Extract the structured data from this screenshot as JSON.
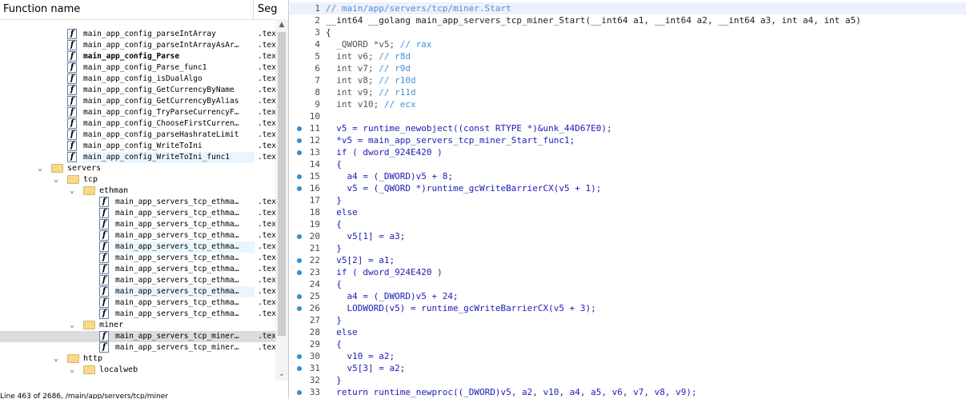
{
  "colors": {
    "comment": "#4a8fd8",
    "code": "#1b1bb8",
    "dot": "#2d8fd5",
    "folder": "#f6d98a",
    "selected_row": "#dcdcdc"
  },
  "func_panel": {
    "col_name": "Function name",
    "col_seg": "Segment",
    "rows": [
      {
        "kind": "fn",
        "indent": 84,
        "name": "main_app_config_parseIntArray",
        "seg": ".text"
      },
      {
        "kind": "fn",
        "indent": 84,
        "name": "main_app_config_parseIntArrayAsAr…",
        "seg": ".text"
      },
      {
        "kind": "fn",
        "indent": 84,
        "name": "main_app_config_Parse",
        "seg": ".text",
        "bold": true
      },
      {
        "kind": "fn",
        "indent": 84,
        "name": "main_app_config_Parse_func1",
        "seg": ".text"
      },
      {
        "kind": "fn",
        "indent": 84,
        "name": "main_app_config_isDualAlgo",
        "seg": ".text"
      },
      {
        "kind": "fn",
        "indent": 84,
        "name": "main_app_config_GetCurrencyByName",
        "seg": ".text"
      },
      {
        "kind": "fn",
        "indent": 84,
        "name": "main_app_config_GetCurrencyByAlias",
        "seg": ".text"
      },
      {
        "kind": "fn",
        "indent": 84,
        "name": "main_app_config_TryParseCurrencyF…",
        "seg": ".text"
      },
      {
        "kind": "fn",
        "indent": 84,
        "name": "main_app_config_ChooseFirstCurren…",
        "seg": ".text"
      },
      {
        "kind": "fn",
        "indent": 84,
        "name": "main_app_config_parseHashrateLimit",
        "seg": ".text"
      },
      {
        "kind": "fn",
        "indent": 84,
        "name": "main_app_config_WriteToIni",
        "seg": ".text"
      },
      {
        "kind": "fn",
        "indent": 84,
        "name": "main_app_config_WriteToIni_func1",
        "seg": ".text",
        "hl": true
      },
      {
        "kind": "folder",
        "indent": 44,
        "name": "servers"
      },
      {
        "kind": "folder",
        "indent": 64,
        "name": "tcp"
      },
      {
        "kind": "folder",
        "indent": 84,
        "name": "ethman"
      },
      {
        "kind": "fn",
        "indent": 124,
        "name": "main_app_servers_tcp_ethma…",
        "seg": ".text"
      },
      {
        "kind": "fn",
        "indent": 124,
        "name": "main_app_servers_tcp_ethma…",
        "seg": ".text"
      },
      {
        "kind": "fn",
        "indent": 124,
        "name": "main_app_servers_tcp_ethma…",
        "seg": ".text"
      },
      {
        "kind": "fn",
        "indent": 124,
        "name": "main_app_servers_tcp_ethma…",
        "seg": ".text"
      },
      {
        "kind": "fn",
        "indent": 124,
        "name": "main_app_servers_tcp_ethma…",
        "seg": ".text",
        "hl": true
      },
      {
        "kind": "fn",
        "indent": 124,
        "name": "main_app_servers_tcp_ethma…",
        "seg": ".text"
      },
      {
        "kind": "fn",
        "indent": 124,
        "name": "main_app_servers_tcp_ethma…",
        "seg": ".text"
      },
      {
        "kind": "fn",
        "indent": 124,
        "name": "main_app_servers_tcp_ethma…",
        "seg": ".text"
      },
      {
        "kind": "fn",
        "indent": 124,
        "name": "main_app_servers_tcp_ethma…",
        "seg": ".text",
        "hl": true
      },
      {
        "kind": "fn",
        "indent": 124,
        "name": "main_app_servers_tcp_ethma…",
        "seg": ".text"
      },
      {
        "kind": "fn",
        "indent": 124,
        "name": "main_app_servers_tcp_ethma…",
        "seg": ".text"
      },
      {
        "kind": "folder",
        "indent": 84,
        "name": "miner"
      },
      {
        "kind": "fn",
        "indent": 124,
        "name": "main_app_servers_tcp_miner…",
        "seg": ".text",
        "selected": true
      },
      {
        "kind": "fn",
        "indent": 124,
        "name": "main_app_servers_tcp_miner…",
        "seg": ".text"
      },
      {
        "kind": "folder",
        "indent": 64,
        "name": "http"
      },
      {
        "kind": "folder",
        "indent": 84,
        "name": "localweb"
      }
    ],
    "status": "Line 463 of 2686, /main/app/servers/tcp/miner"
  },
  "code": {
    "lines": [
      {
        "n": "1",
        "t": "// main/app/servers/tcp/miner.Start",
        "cls": "comment",
        "dot": false,
        "current": true
      },
      {
        "n": "2",
        "t": "__int64 __golang main_app_servers_tcp_miner_Start(__int64 a1, __int64 a2, __int64 a3, int a4, int a5)",
        "cls": "plain",
        "dot": false
      },
      {
        "n": "3",
        "t": "{",
        "cls": "plain",
        "dot": false
      },
      {
        "n": "4",
        "t": "  _QWORD *v5; // rax",
        "cls": "mixed",
        "dot": false
      },
      {
        "n": "5",
        "t": "  int v6; // r8d",
        "cls": "mixed",
        "dot": false
      },
      {
        "n": "6",
        "t": "  int v7; // r9d",
        "cls": "mixed",
        "dot": false
      },
      {
        "n": "7",
        "t": "  int v8; // r10d",
        "cls": "mixed",
        "dot": false
      },
      {
        "n": "8",
        "t": "  int v9; // r11d",
        "cls": "mixed",
        "dot": false
      },
      {
        "n": "9",
        "t": "  int v10; // ecx",
        "cls": "mixed",
        "dot": false
      },
      {
        "n": "10",
        "t": "",
        "cls": "plain",
        "dot": false
      },
      {
        "n": "11",
        "t": "  v5 = runtime_newobject((const RTYPE *)&unk_44D67E0);",
        "cls": "code",
        "dot": true
      },
      {
        "n": "12",
        "t": "  *v5 = main_app_servers_tcp_miner_Start_func1;",
        "cls": "code",
        "dot": true
      },
      {
        "n": "13",
        "t": "  if ( dword_924E420 )",
        "cls": "code",
        "dot": true
      },
      {
        "n": "14",
        "t": "  {",
        "cls": "code",
        "dot": false
      },
      {
        "n": "15",
        "t": "    a4 = (_DWORD)v5 + 8;",
        "cls": "code",
        "dot": true
      },
      {
        "n": "16",
        "t": "    v5 = (_QWORD *)runtime_gcWriteBarrierCX(v5 + 1);",
        "cls": "code",
        "dot": true
      },
      {
        "n": "17",
        "t": "  }",
        "cls": "code",
        "dot": false
      },
      {
        "n": "18",
        "t": "  else",
        "cls": "code",
        "dot": false
      },
      {
        "n": "19",
        "t": "  {",
        "cls": "code",
        "dot": false
      },
      {
        "n": "20",
        "t": "    v5[1] = a3;",
        "cls": "code",
        "dot": true
      },
      {
        "n": "21",
        "t": "  }",
        "cls": "code",
        "dot": false
      },
      {
        "n": "22",
        "t": "  v5[2] = a1;",
        "cls": "code",
        "dot": true
      },
      {
        "n": "23",
        "t": "  if ( dword_924E420 )",
        "cls": "code",
        "dot": true
      },
      {
        "n": "24",
        "t": "  {",
        "cls": "code",
        "dot": false
      },
      {
        "n": "25",
        "t": "    a4 = (_DWORD)v5 + 24;",
        "cls": "code",
        "dot": true
      },
      {
        "n": "26",
        "t": "    LODWORD(v5) = runtime_gcWriteBarrierCX(v5 + 3);",
        "cls": "code",
        "dot": true
      },
      {
        "n": "27",
        "t": "  }",
        "cls": "code",
        "dot": false
      },
      {
        "n": "28",
        "t": "  else",
        "cls": "code",
        "dot": false
      },
      {
        "n": "29",
        "t": "  {",
        "cls": "code",
        "dot": false
      },
      {
        "n": "30",
        "t": "    v10 = a2;",
        "cls": "code",
        "dot": true
      },
      {
        "n": "31",
        "t": "    v5[3] = a2;",
        "cls": "code",
        "dot": true
      },
      {
        "n": "32",
        "t": "  }",
        "cls": "code",
        "dot": false
      },
      {
        "n": "33",
        "t": "  return runtime_newproc((_DWORD)v5, a2, v10, a4, a5, v6, v7, v8, v9);",
        "cls": "code",
        "dot": true
      }
    ]
  }
}
